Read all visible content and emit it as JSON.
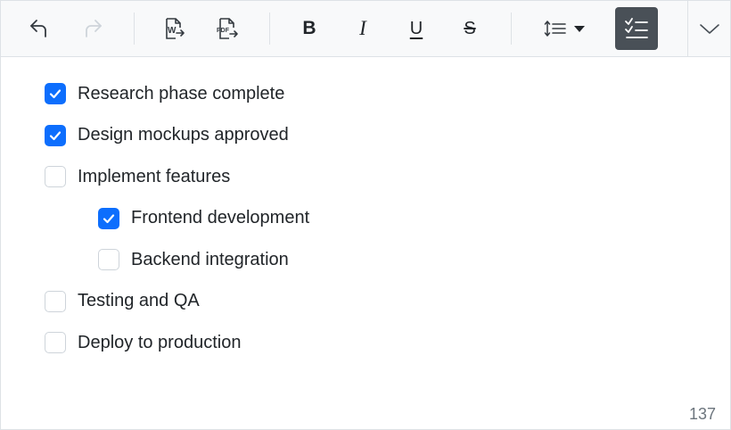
{
  "toolbar": {
    "buttons": [
      {
        "name": "undo-button",
        "icon": "undo-icon"
      },
      {
        "name": "redo-button",
        "icon": "redo-icon",
        "disabled": true
      },
      {
        "name": "export-word-button",
        "icon": "export-word-icon",
        "glyph": "W"
      },
      {
        "name": "export-pdf-button",
        "icon": "export-pdf-icon",
        "glyph": "PDF"
      },
      {
        "name": "bold-button",
        "icon": "bold-icon",
        "glyph": "B"
      },
      {
        "name": "italic-button",
        "icon": "italic-icon",
        "glyph": "I"
      },
      {
        "name": "underline-button",
        "icon": "underline-icon",
        "glyph": "U"
      },
      {
        "name": "strikethrough-button",
        "icon": "strikethrough-icon",
        "glyph": "S"
      },
      {
        "name": "line-height-dropdown",
        "icon": "line-height-icon"
      },
      {
        "name": "checklist-button",
        "icon": "checklist-icon",
        "active": true
      },
      {
        "name": "toolbar-overflow-button",
        "icon": "chevron-down-icon"
      }
    ]
  },
  "checklist": {
    "items": [
      {
        "label": "Research phase complete",
        "checked": true,
        "level": 0
      },
      {
        "label": "Design mockups approved",
        "checked": true,
        "level": 0
      },
      {
        "label": "Implement features",
        "checked": false,
        "level": 0
      },
      {
        "label": "Frontend development",
        "checked": true,
        "level": 1
      },
      {
        "label": "Backend integration",
        "checked": false,
        "level": 1
      },
      {
        "label": "Testing and QA",
        "checked": false,
        "level": 0
      },
      {
        "label": "Deploy to production",
        "checked": false,
        "level": 0
      }
    ]
  },
  "status": {
    "character_count": "137"
  },
  "colors": {
    "accent": "#0d6efd",
    "active_button": "#495057",
    "toolbar_bg": "#f8f9fa",
    "border": "#dee2e6"
  }
}
